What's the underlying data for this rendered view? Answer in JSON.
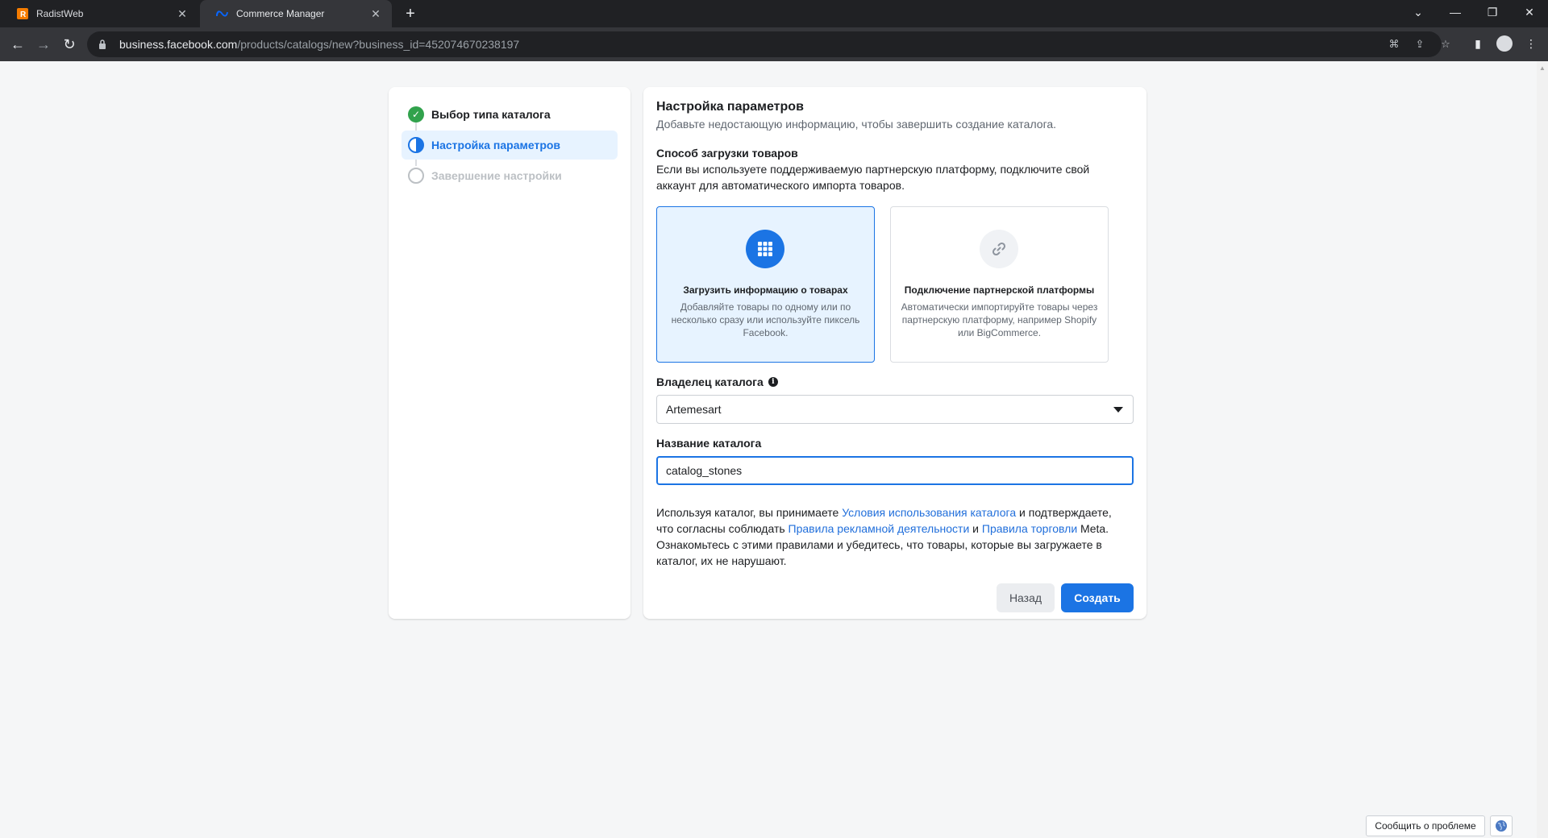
{
  "browser": {
    "tabs": [
      {
        "title": "RadistWeb",
        "close": "✕"
      },
      {
        "title": "Commerce Manager",
        "close": "✕"
      }
    ],
    "new_tab": "+",
    "url_domain": "business.facebook.com",
    "url_path": "/products/catalogs/new?business_id=452074670238197",
    "colors": {
      "radist_favicon": "#f57c00",
      "meta_blue": "#0866ff"
    }
  },
  "steps": {
    "items": [
      {
        "label": "Выбор типа каталога",
        "state": "done"
      },
      {
        "label": "Настройка параметров",
        "state": "current"
      },
      {
        "label": "Завершение настройки",
        "state": "pending"
      }
    ]
  },
  "main": {
    "title": "Настройка параметров",
    "subtitle": "Добавьте недостающую информацию, чтобы завершить создание каталога.",
    "upload_method": {
      "label": "Способ загрузки товаров",
      "description": "Если вы используете поддерживаемую партнерскую платформу, подключите свой аккаунт для автоматического импорта товаров.",
      "options": [
        {
          "title": "Загрузить информацию о товарах",
          "description": "Добавляйте товары по одному или по несколько сразу или используйте пиксель Facebook.",
          "icon": "grid-icon",
          "selected": true
        },
        {
          "title": "Подключение партнерской платформы",
          "description": "Автоматически импортируйте товары через партнерскую платформу, например Shopify или BigCommerce.",
          "icon": "link-icon",
          "selected": false
        }
      ]
    },
    "owner": {
      "label": "Владелец каталога",
      "value": "Artemesart"
    },
    "catalog_name": {
      "label": "Название каталога",
      "value": "catalog_stones"
    },
    "terms": {
      "t1": "Используя каталог, вы принимаете ",
      "link1": "Условия использования каталога",
      "t2": " и подтверждаете, что согласны соблюдать ",
      "link2": "Правила рекламной деятельности",
      "t3": " и ",
      "link3": "Правила торговли",
      "t4": " Meta. Ознакомьтесь с этими правилами и убедитесь, что товары, которые вы загружаете в каталог, их не нарушают."
    },
    "buttons": {
      "back": "Назад",
      "create": "Создать"
    }
  },
  "footer": {
    "report": "Сообщить о проблеме"
  },
  "colors": {
    "accent": "#1b74e4",
    "success": "#31a24c",
    "selected_bg": "#e7f3ff"
  }
}
